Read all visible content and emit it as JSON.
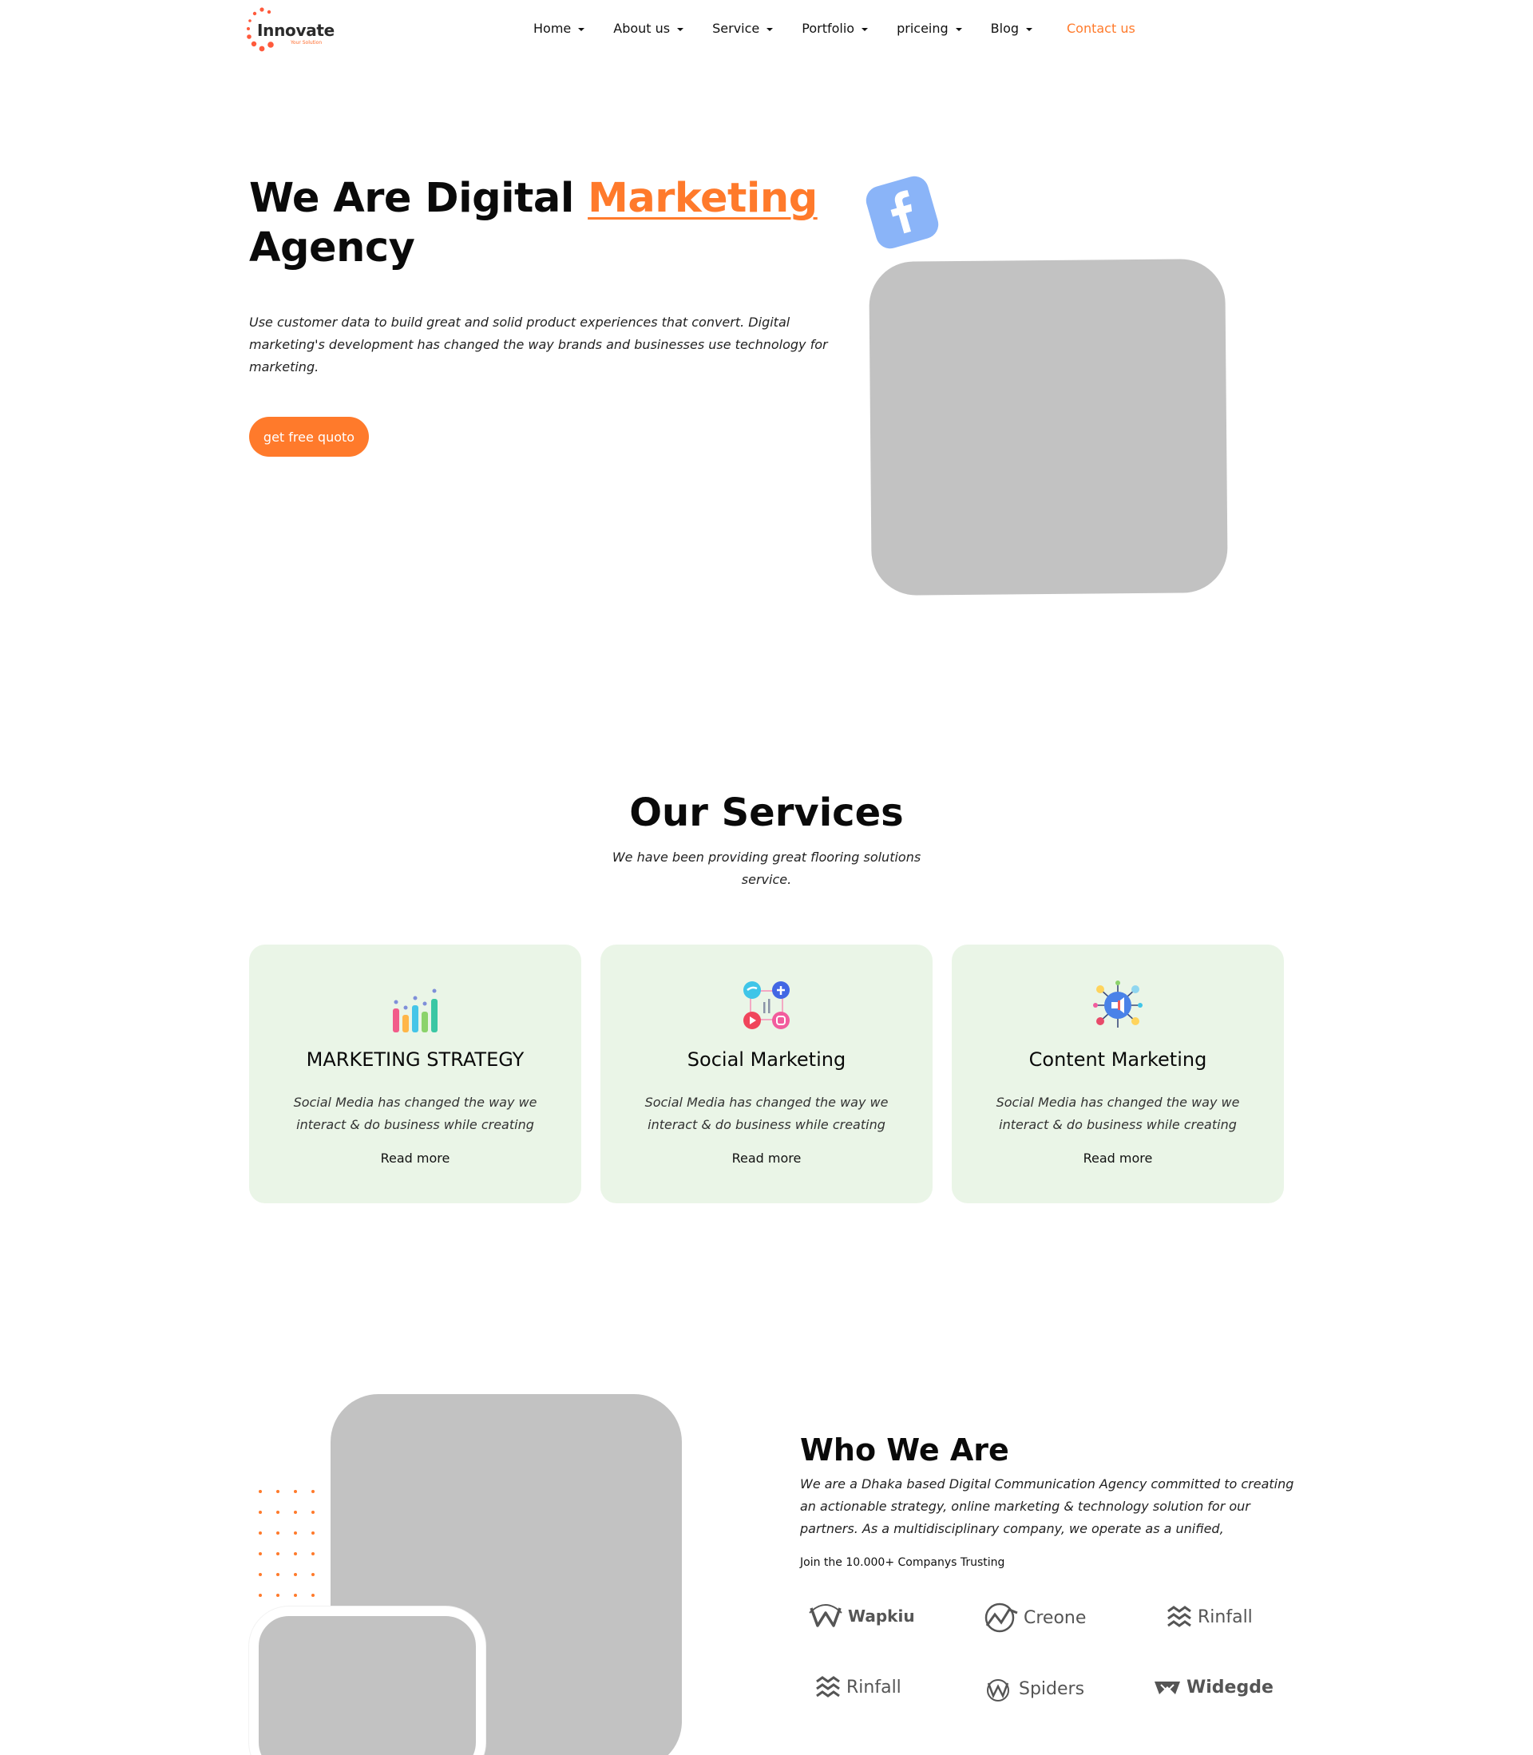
{
  "header": {
    "logo": {
      "name": "Innovate",
      "tagline": "Your Solution"
    },
    "nav": [
      {
        "label": "Home"
      },
      {
        "label": "About us"
      },
      {
        "label": "Service"
      },
      {
        "label": "Portfolio"
      },
      {
        "label": "priceing"
      },
      {
        "label": "Blog"
      }
    ],
    "contact_label": "Contact us"
  },
  "hero": {
    "title_part1": "We Are Digital ",
    "title_accent": "Marketing",
    "title_part2": "Agency",
    "description": "Use customer data to build great and solid product experiences that convert. Digital marketing's development has changed the way brands and businesses use technology for marketing.",
    "button_label": "get free quoto",
    "badge_icon": "facebook-icon"
  },
  "services": {
    "title": "Our Services",
    "subtitle": "We have been providing great flooring solutions service.",
    "cards": [
      {
        "icon": "bar-chart-icon",
        "title": "MARKETING STRATEGY",
        "description": "Social Media has changed the way we interact & do business while creating",
        "link": "Read more"
      },
      {
        "icon": "social-network-icon",
        "title": "Social Marketing",
        "description": "Social Media has changed the way we interact & do business while creating",
        "link": "Read more"
      },
      {
        "icon": "megaphone-icon",
        "title": "Content Marketing",
        "description": "Social Media has changed the way we interact & do business while creating",
        "link": "Read more"
      }
    ]
  },
  "who": {
    "title": "Who We Are",
    "description": "We are a Dhaka based Digital Communication Agency committed to creating an actionable strategy, online marketing & technology solution for our partners. As a multidisciplinary company, we operate as a unified,",
    "join_text": "Join the 10.000+ Companys Trusting",
    "brands": [
      {
        "name": "Wapkiu",
        "icon": "wapkiu-logo-icon"
      },
      {
        "name": "Creone",
        "icon": "creone-logo-icon"
      },
      {
        "name": "Rinfall",
        "icon": "rinfall-logo-icon"
      },
      {
        "name": "Rinfall",
        "icon": "rinfall-logo-icon"
      },
      {
        "name": "Spiders",
        "icon": "spiders-logo-icon"
      },
      {
        "name": "Widegde",
        "icon": "widegde-logo-icon"
      }
    ]
  },
  "colors": {
    "accent": "#ff7a2b",
    "card_bg": "#eaf5e7",
    "placeholder": "#c2c2c2",
    "facebook_badge": "#8ab4f8"
  }
}
